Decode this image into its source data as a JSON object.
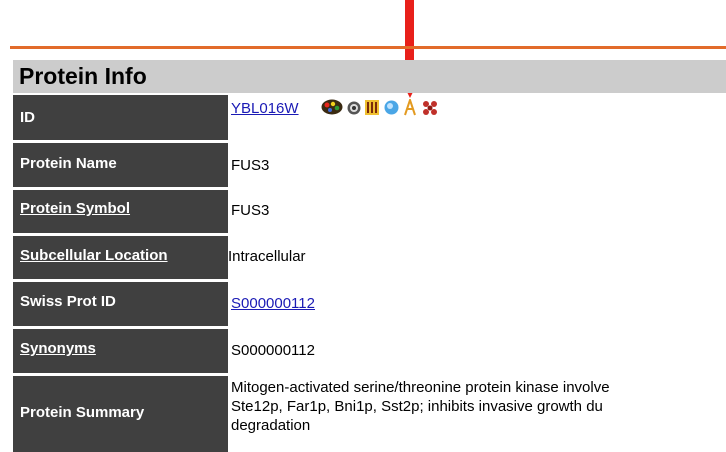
{
  "panel": {
    "title": "Protein Info"
  },
  "rows": [
    {
      "label": "ID",
      "value": "YBL016W",
      "value_type": "link"
    },
    {
      "label": "Protein Name",
      "value": "FUS3",
      "value_type": "text"
    },
    {
      "label": "Protein Symbol",
      "value": "FUS3",
      "value_type": "text",
      "label_link": true
    },
    {
      "label": "Subcellular Location",
      "value": "Intracellular",
      "value_type": "text",
      "label_link": true
    },
    {
      "label": "Swiss Prot ID",
      "value": "S000000112",
      "value_type": "link"
    },
    {
      "label": "Synonyms",
      "value": "S000000112",
      "value_type": "text",
      "label_link": true
    },
    {
      "label": "Protein Summary",
      "value_lines": [
        "Mitogen-activated serine/threonine protein kinase involve",
        "Ste12p, Far1p, Bni1p, Sst2p; inhibits invasive growth du",
        "degradation"
      ]
    }
  ],
  "id_icons": [
    "kegg-pathway-icon",
    "sgd-icon",
    "omim-icon",
    "blast-icon",
    "text-abstract-icon",
    "structure-icon"
  ],
  "colors": {
    "label_bg": "#404040",
    "header_bg": "#cccccc",
    "rule": "#e26b2a",
    "link": "#1a1ab5",
    "arrow": "#e8201a"
  }
}
